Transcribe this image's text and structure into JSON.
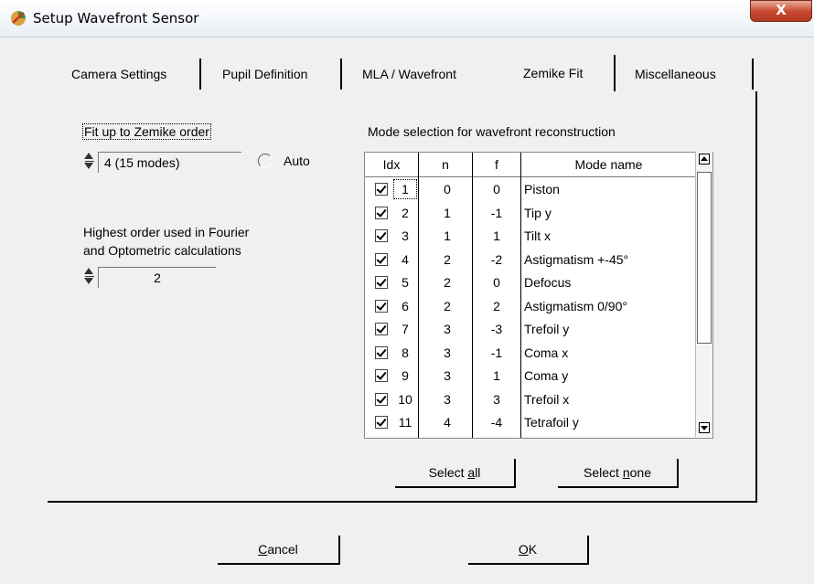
{
  "window": {
    "title": "Setup Wavefront Sensor",
    "close_glyph": "X"
  },
  "tabs": [
    {
      "label": "Camera Settings"
    },
    {
      "label": "Pupil Definition"
    },
    {
      "label": "MLA / Wavefront"
    },
    {
      "label": "Zemike Fit",
      "active": true
    },
    {
      "label": "Miscellaneous"
    }
  ],
  "fit": {
    "label": "Fit up to Zemike order",
    "value": "4  (15 modes)",
    "auto_label": "Auto"
  },
  "highest": {
    "label_line1": "Highest order used in Fourier",
    "label_line2": "and Optometric calculations",
    "value": "2"
  },
  "modes": {
    "heading": "Mode selection for wavefront reconstruction",
    "columns": {
      "idx": "Idx",
      "n": "n",
      "f": "f",
      "name": "Mode name"
    },
    "rows": [
      {
        "idx": "1",
        "n": "0",
        "f": "0",
        "name": "Piston"
      },
      {
        "idx": "2",
        "n": "1",
        "f": "-1",
        "name": "Tip y"
      },
      {
        "idx": "3",
        "n": "1",
        "f": "1",
        "name": "Tilt x"
      },
      {
        "idx": "4",
        "n": "2",
        "f": "-2",
        "name": "Astigmatism +-45°"
      },
      {
        "idx": "5",
        "n": "2",
        "f": "0",
        "name": "Defocus"
      },
      {
        "idx": "6",
        "n": "2",
        "f": "2",
        "name": "Astigmatism 0/90°"
      },
      {
        "idx": "7",
        "n": "3",
        "f": "-3",
        "name": "Trefoil y"
      },
      {
        "idx": "8",
        "n": "3",
        "f": "-1",
        "name": "Coma x"
      },
      {
        "idx": "9",
        "n": "3",
        "f": "1",
        "name": "Coma y"
      },
      {
        "idx": "10",
        "n": "3",
        "f": "3",
        "name": "Trefoil x"
      },
      {
        "idx": "11",
        "n": "4",
        "f": "-4",
        "name": "Tetrafoil y"
      }
    ]
  },
  "buttons": {
    "select_all": {
      "pre": "Select ",
      "u": "a",
      "post": "ll"
    },
    "select_none": {
      "pre": "Select ",
      "u": "n",
      "post": "one"
    },
    "cancel": {
      "pre": "",
      "u": "C",
      "post": "ancel"
    },
    "ok": {
      "pre": "",
      "u": "O",
      "post": "K"
    }
  },
  "icons": {
    "app": "wavefront-app-icon",
    "close": "close-icon",
    "spinner": "spinner-arrows-icon",
    "check": "checkmark-icon",
    "scroll_up": "scroll-up-arrow-icon",
    "scroll_down": "scroll-down-arrow-icon"
  },
  "colors": {
    "close_button": "#c7472e",
    "title_bar": "#e9eef6",
    "panel": "#f0f0f0"
  }
}
